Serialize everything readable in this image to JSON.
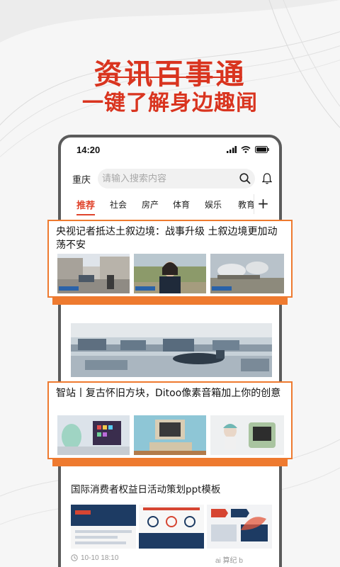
{
  "promo": {
    "headline": "资讯百事通",
    "subheadline": "一键了解身边趣闻"
  },
  "statusbar": {
    "time": "14:20",
    "icons": [
      "signal-icon",
      "wifi-icon",
      "battery-icon"
    ]
  },
  "header": {
    "city": "重庆",
    "search_placeholder": "请输入搜索内容"
  },
  "tabs": [
    {
      "label": "推荐",
      "active": true
    },
    {
      "label": "社会",
      "active": false
    },
    {
      "label": "房产",
      "active": false
    },
    {
      "label": "体育",
      "active": false
    },
    {
      "label": "娱乐",
      "active": false
    },
    {
      "label": "教育",
      "active": false
    }
  ],
  "tab_add_label": "+",
  "feed": [
    {
      "title": "央视记者抵达土叙边境：战事升级 土叙边境更加动荡不安",
      "highlighted": true
    },
    {
      "title": "",
      "highlighted": false
    },
    {
      "title": "智站丨复古怀旧方块，Ditoo像素音箱加上你的创意",
      "highlighted": true
    },
    {
      "title": "国际消费者权益日活动策划ppt模板",
      "highlighted": false,
      "time": "10-10 18:10",
      "source": "ai 算纪 b"
    }
  ],
  "colors": {
    "accent": "#d9341f",
    "highlight_border": "#ee7a2f",
    "tab_active": "#e0442c"
  }
}
